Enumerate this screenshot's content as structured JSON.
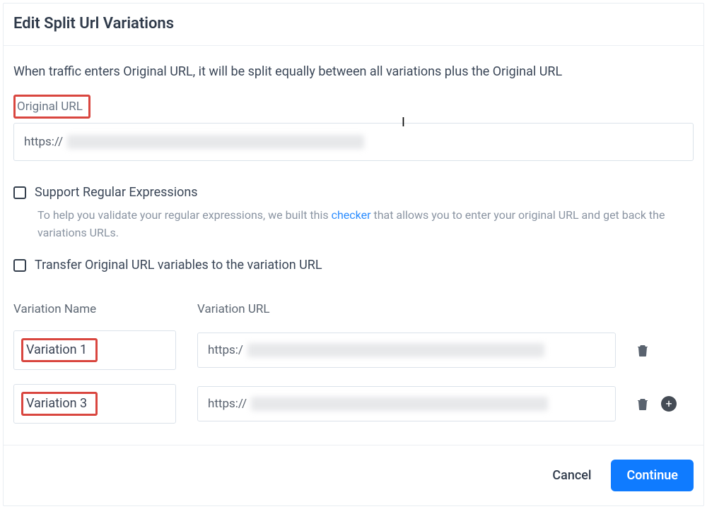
{
  "header": {
    "title": "Edit Split Url Variations"
  },
  "description": "When traffic enters Original URL, it will be split equally between all variations plus the Original URL",
  "originalUrl": {
    "label": "Original URL",
    "prefix": "https://"
  },
  "regex": {
    "label": "Support Regular Expressions",
    "helper_pre": "To help you validate your regular expressions, we built this ",
    "helper_link": "checker",
    "helper_post": " that allows you to enter your original URL and get back the variations URLs."
  },
  "transfer": {
    "label": "Transfer Original URL variables to the variation URL"
  },
  "columns": {
    "name": "Variation Name",
    "url": "Variation URL"
  },
  "variations": [
    {
      "name": "Variation 1",
      "prefix": "https:/"
    },
    {
      "name": "Variation 3",
      "prefix": "https://"
    }
  ],
  "footer": {
    "cancel": "Cancel",
    "continue": "Continue"
  }
}
